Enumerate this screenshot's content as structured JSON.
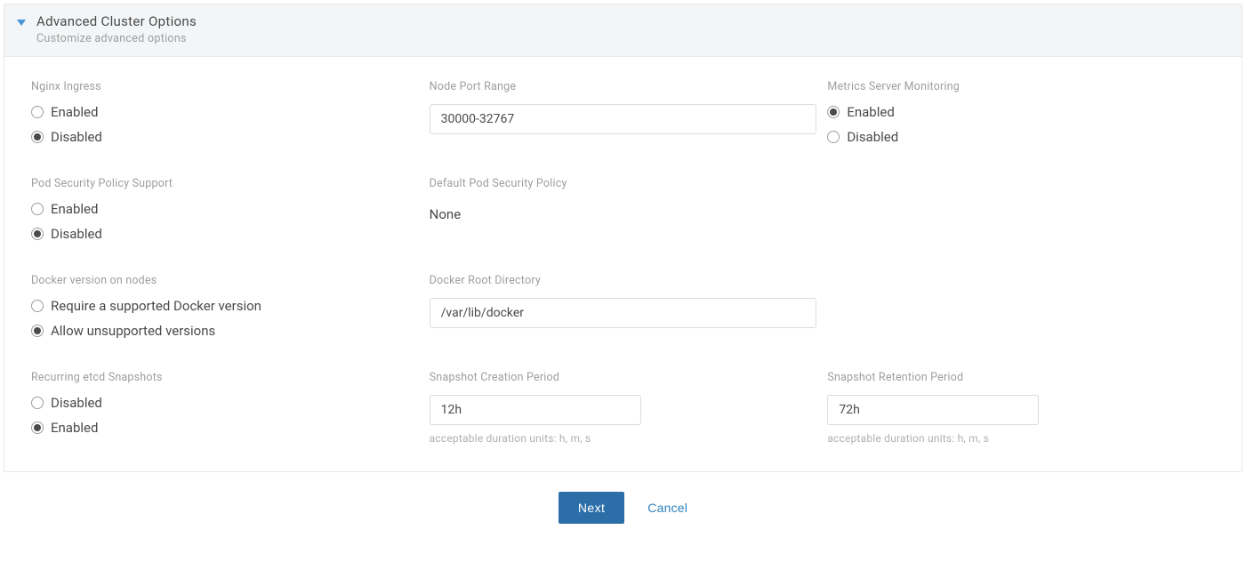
{
  "panel": {
    "title": "Advanced Cluster Options",
    "subtitle": "Customize advanced options"
  },
  "nginx_ingress": {
    "label": "Nginx Ingress",
    "opt_enabled": "Enabled",
    "opt_disabled": "Disabled",
    "selected": "disabled"
  },
  "node_port_range": {
    "label": "Node Port Range",
    "value": "30000-32767"
  },
  "metrics_server": {
    "label": "Metrics Server Monitoring",
    "opt_enabled": "Enabled",
    "opt_disabled": "Disabled",
    "selected": "enabled"
  },
  "pod_security": {
    "label": "Pod Security Policy Support",
    "opt_enabled": "Enabled",
    "opt_disabled": "Disabled",
    "selected": "disabled"
  },
  "default_psp": {
    "label": "Default Pod Security Policy",
    "value": "None"
  },
  "docker_version": {
    "label": "Docker version on nodes",
    "opt_require": "Require a supported Docker version",
    "opt_allow": "Allow unsupported versions",
    "selected": "allow"
  },
  "docker_root": {
    "label": "Docker Root Directory",
    "value": "/var/lib/docker"
  },
  "etcd_snapshots": {
    "label": "Recurring etcd Snapshots",
    "opt_disabled": "Disabled",
    "opt_enabled": "Enabled",
    "selected": "enabled"
  },
  "snapshot_creation": {
    "label": "Snapshot Creation Period",
    "value": "12h",
    "help": "acceptable duration units: h, m, s"
  },
  "snapshot_retention": {
    "label": "Snapshot Retention Period",
    "value": "72h",
    "help": "acceptable duration units: h, m, s"
  },
  "footer": {
    "next": "Next",
    "cancel": "Cancel"
  }
}
